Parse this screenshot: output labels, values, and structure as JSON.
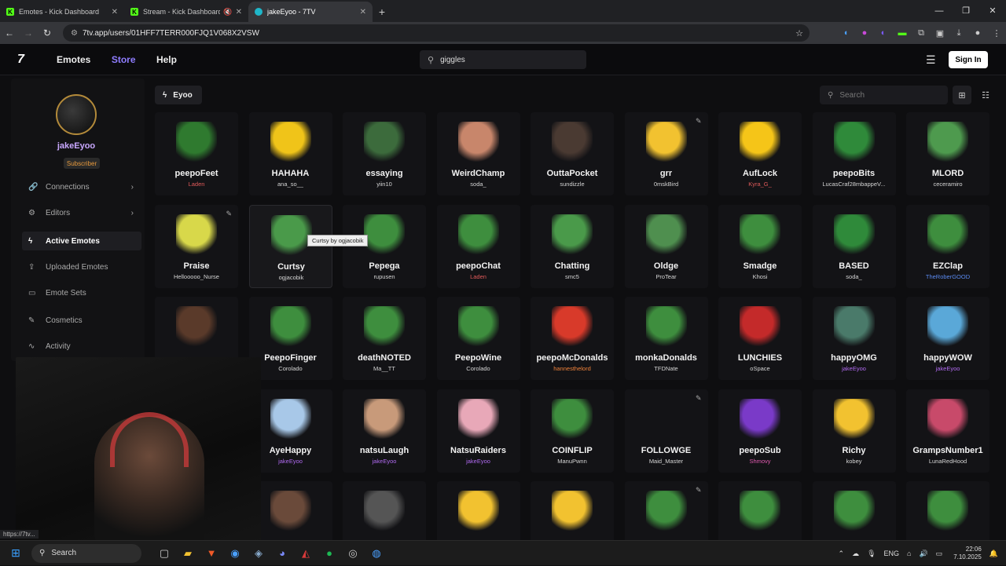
{
  "browser": {
    "tabs": [
      {
        "title": "Emotes - Kick Dashboard",
        "favicon": "K"
      },
      {
        "title": "Stream - Kick Dashboard",
        "favicon": "K"
      },
      {
        "title": "jakeEyoo - 7TV",
        "favicon": ""
      }
    ],
    "url": "7tv.app/users/01HFF7TERR000FJQ1V068X2VSW",
    "status_url": "https://7tv..."
  },
  "site": {
    "logo": "7",
    "nav": [
      "Emotes",
      "Store",
      "Help"
    ],
    "search_value": "giggles",
    "signin": "Sign In"
  },
  "sidebar": {
    "username": "jakeEyoo",
    "badge": "Subscriber",
    "items": [
      {
        "label": "Connections",
        "icon": "link-icon"
      },
      {
        "label": "Editors",
        "icon": "settings-icon"
      },
      {
        "label": "Active Emotes",
        "icon": "bolt-icon"
      },
      {
        "label": "Uploaded Emotes",
        "icon": "upload-icon"
      },
      {
        "label": "Emote Sets",
        "icon": "folder-icon"
      },
      {
        "label": "Cosmetics",
        "icon": "brush-icon"
      },
      {
        "label": "Activity",
        "icon": "activity-icon"
      }
    ]
  },
  "content": {
    "set_name": "Eyoo",
    "search_placeholder": "Search",
    "tooltip": "Curtsy by ogjacobik",
    "emotes": [
      {
        "name": "peepoFeet",
        "author": "Laden",
        "color": "#2f7a2f"
      },
      {
        "name": "HAHAHA",
        "author": "ana_so__",
        "color": "#f0c419"
      },
      {
        "name": "essaying",
        "author": "yiin10",
        "color": "#3c6b3c"
      },
      {
        "name": "WeirdChamp",
        "author": "soda_",
        "color": "#c8866b"
      },
      {
        "name": "OuttaPocket",
        "author": "sundizzle",
        "color": "#4a3a32"
      },
      {
        "name": "grr",
        "author": "0mskBird",
        "color": "#f2c230"
      },
      {
        "name": "AufLock",
        "author": "Kyra_G_",
        "color": "#f5c518"
      },
      {
        "name": "peepoBits",
        "author": "LucasCraf28mbappeV...",
        "color": "#2f8a3a"
      },
      {
        "name": "MLORD",
        "author": "ceceramiro",
        "color": "#4e9a4e"
      },
      {
        "name": "Praise",
        "author": "Hellooooo_Nurse",
        "color": "#d8d84a"
      },
      {
        "name": "Curtsy",
        "author": "ogjacobik",
        "color": "#4a9a4a"
      },
      {
        "name": "Pepega",
        "author": "rupusen",
        "color": "#3e8e3e"
      },
      {
        "name": "peepoChat",
        "author": "Laden",
        "color": "#3e8e3e"
      },
      {
        "name": "Chatting",
        "author": "smc5",
        "color": "#4a9a4a"
      },
      {
        "name": "Oldge",
        "author": "ProTear",
        "color": "#4f8f4f"
      },
      {
        "name": "Smadge",
        "author": "Khosi",
        "color": "#3e8e3e"
      },
      {
        "name": "BASED",
        "author": "soda_",
        "color": "#2f8a3a"
      },
      {
        "name": "EZClap",
        "author": "TheRoberGOOD",
        "color": "#3e8e3e"
      },
      {
        "name": "",
        "author": "",
        "color": "#5a3a2a"
      },
      {
        "name": "PeepoFinger",
        "author": "Corolado",
        "color": "#3e8e3e"
      },
      {
        "name": "deathNOTED",
        "author": "Ma__TT",
        "color": "#3e8e3e"
      },
      {
        "name": "PeepoWine",
        "author": "Corolado",
        "color": "#3e8e3e"
      },
      {
        "name": "peepoMcDonalds",
        "author": "hannesthelord",
        "color": "#d83a2a"
      },
      {
        "name": "monkaDonalds",
        "author": "TFDNate",
        "color": "#3e8e3e"
      },
      {
        "name": "LUNCHIES",
        "author": "oSpace",
        "color": "#c42a2a"
      },
      {
        "name": "happyOMG",
        "author": "jakeEyoo",
        "color": "#4a7a6a"
      },
      {
        "name": "happyWOW",
        "author": "jakeEyoo",
        "color": "#5aa8d8"
      },
      {
        "name": "",
        "author": "",
        "color": "#121214"
      },
      {
        "name": "AyeHappy",
        "author": "jakeEyoo",
        "color": "#a8c8e8"
      },
      {
        "name": "natsuLaugh",
        "author": "jakeEyoo",
        "color": "#c89a7a"
      },
      {
        "name": "NatsuRaiders",
        "author": "jakeEyoo",
        "color": "#e8a8b8"
      },
      {
        "name": "COINFLIP",
        "author": "ManuPwnn",
        "color": "#3e8e3e"
      },
      {
        "name": "FOLLOWGE",
        "author": "Maid_Master",
        "color": "#131316"
      },
      {
        "name": "peepoSub",
        "author": "Shmovy",
        "color": "#7a3ac8"
      },
      {
        "name": "Richy",
        "author": "kobey",
        "color": "#f2c230"
      },
      {
        "name": "GrampsNumber1",
        "author": "LunaRedHood",
        "color": "#c84a6a"
      },
      {
        "name": "",
        "author": "",
        "color": "#d83a5a"
      },
      {
        "name": "",
        "author": "",
        "color": "#6a4a3a"
      },
      {
        "name": "",
        "author": "",
        "color": "#555555"
      },
      {
        "name": "",
        "author": "",
        "color": "#f2c230"
      },
      {
        "name": "",
        "author": "",
        "color": "#f2c230"
      },
      {
        "name": "",
        "author": "",
        "color": "#3e8e3e"
      },
      {
        "name": "",
        "author": "",
        "color": "#3e8e3e"
      },
      {
        "name": "",
        "author": "",
        "color": "#3e8e3e"
      },
      {
        "name": "",
        "author": "",
        "color": "#3e8e3e"
      }
    ]
  },
  "taskbar": {
    "search": "Search",
    "lang": "ENG",
    "time": "22:06",
    "date": "7.10.2025"
  }
}
